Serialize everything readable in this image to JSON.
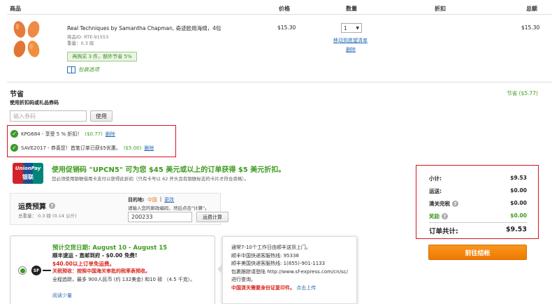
{
  "table_headers": {
    "product": "商品",
    "price": "价格",
    "quantity": "数量",
    "discount": "折扣",
    "total": "总额"
  },
  "item": {
    "name": "Real Techniques by Samantha Chapman, 奇迹脸用海绵，4包",
    "product_id": "商品ID: RTE-91553",
    "weight": "重量：0.3 磅",
    "promo": "再购买 3 件，额外节省 5%",
    "gift_wrap": "包装选项",
    "price": "$15.30",
    "qty": "1",
    "move_to_wishlist": "移动到愿望清单",
    "remove": "删除",
    "total": "$15.30"
  },
  "savings": {
    "title": "节省",
    "subtitle": "使用折扣码或礼品券码",
    "amount": "节省 ($5.77)",
    "coupon_placeholder": "输入券码",
    "apply": "使用",
    "codes": [
      {
        "text": "KPG684 - 享受 5 % 折扣！",
        "amount": "($0.77)",
        "remove": "删除"
      },
      {
        "text": "SAVE2017 - 恭喜您！首笔订单已获$5优惠。",
        "amount": "($5.00)",
        "remove": "删除"
      }
    ]
  },
  "unionpay": {
    "logo_top": "UnionPay",
    "logo_bottom": "银联",
    "headline": "使用促销码 \"UPCN5\" 可为您 $45 美元或以上的订单获得 $5 美元折扣。",
    "note": "您必须使用银联借用卡支付以获得此折扣（只有卡号以 62 开头且有银联标志的卡片才符合资格）。"
  },
  "shipping_estimate": {
    "title": "运费预算",
    "weight": "总重量： 0.3 磅 (0.14 公斤)",
    "destination_label": "目的地:",
    "destination": "中国",
    "change": "更改",
    "zip_instruction": "请输入您的邮政编码，然后点击\"计算\"。",
    "zip": "200233",
    "calc": "运费计算"
  },
  "delivery": {
    "date": "预计交货日期: August 10 - August 15",
    "method": "顺丰速运 - 直邮到府 - $0.00 免费!",
    "free_note": "$40.00以上订单免运费。",
    "tax_note": "关税预收：按照中国海关审批的税率表预收。",
    "desc": "全程追踪，最多 900人民币 (约 132美金) 和10 磅 （4.5 千克）。",
    "read_less": "阅读少量",
    "carrier_logo": "SF"
  },
  "tooltip": {
    "line1": "通常7-10个工作日由顺丰送货上门。",
    "line2": "顺丰中国快递客服热线: 95338",
    "line3": "顺丰美国快递客服热线: 1(855)-901-1133",
    "line4": "包裹跟踪请登陆 http://www.sf-express.com/cn/sc/ 进行查询。",
    "line5_red": "中国清关需要身份证复印件。",
    "line5_link": "点击上传"
  },
  "summary": {
    "subtotal_label": "小计:",
    "subtotal": "$9.53",
    "shipping_label": "运送:",
    "shipping": "$0.00",
    "duties_label": "清关完税",
    "duties": "$0.00",
    "rewards_label": "奖励",
    "rewards": "$0.00",
    "total_label": "订单共计:",
    "total": "$9.53",
    "checkout": "前往结帐"
  }
}
